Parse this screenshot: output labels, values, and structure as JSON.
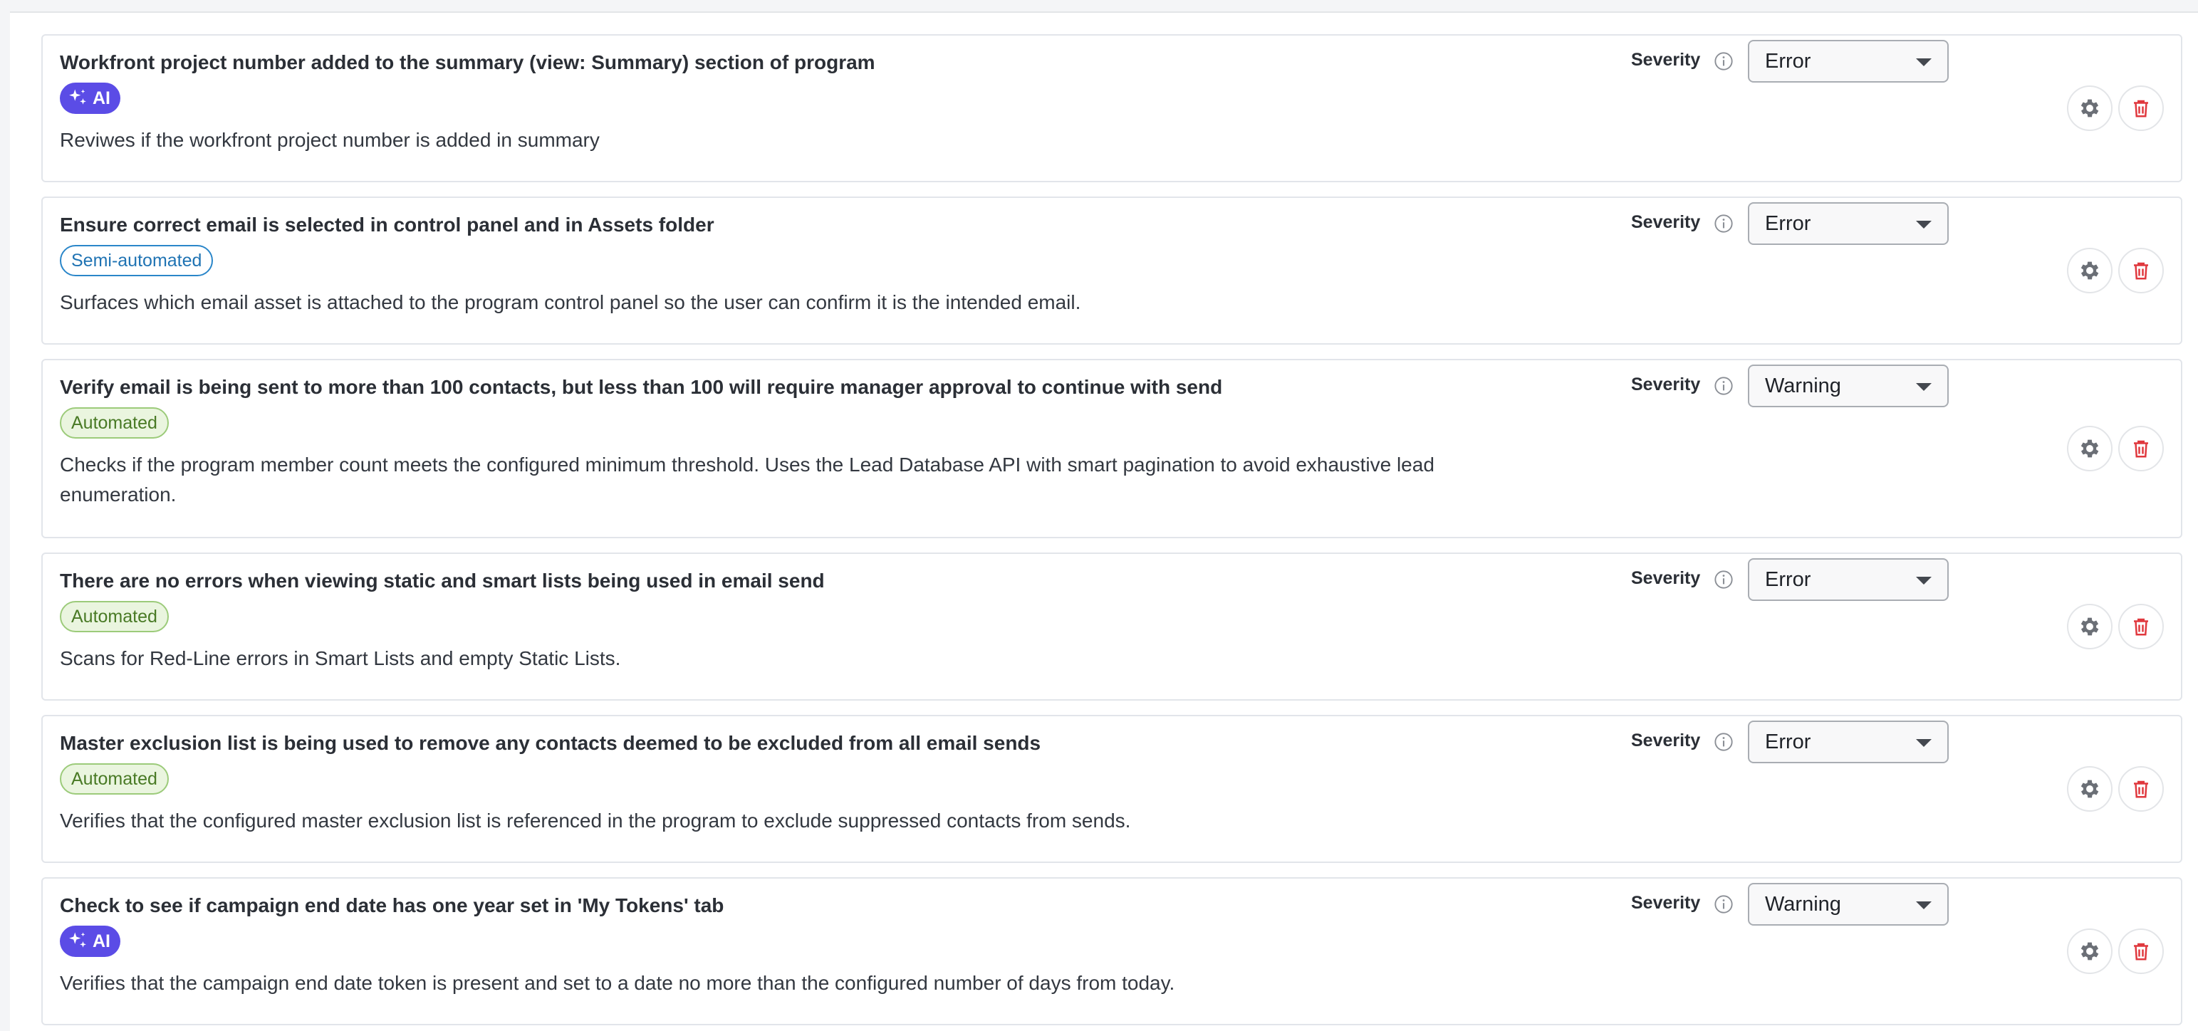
{
  "severity_label": "Severity",
  "rules": [
    {
      "title": "Workfront project number added to the summary (view: Summary) section of program",
      "badge": "AI",
      "badge_type": "ai",
      "description": "Reviwes if the workfront project number is added in summary",
      "severity": "Error"
    },
    {
      "title": "Ensure correct email is selected in control panel and in Assets folder",
      "badge": "Semi-automated",
      "badge_type": "semi",
      "description": "Surfaces which email asset is attached to the program control panel so the user can confirm it is the intended email.",
      "severity": "Error"
    },
    {
      "title": "Verify email is being sent to more than 100 contacts, but less than 100 will require manager approval to continue with send",
      "badge": "Automated",
      "badge_type": "auto",
      "description": "Checks if the program member count meets the configured minimum threshold. Uses the Lead Database API with smart pagination to avoid exhaustive lead enumeration.",
      "severity": "Warning"
    },
    {
      "title": "There are no errors when viewing static and smart lists being used in email send",
      "badge": "Automated",
      "badge_type": "auto",
      "description": "Scans for Red-Line errors in Smart Lists and empty Static Lists.",
      "severity": "Error"
    },
    {
      "title": "Master exclusion list is being used to remove any contacts deemed to be excluded from all email sends",
      "badge": "Automated",
      "badge_type": "auto",
      "description": "Verifies that the configured master exclusion list is referenced in the program to exclude suppressed contacts from sends.",
      "severity": "Error"
    },
    {
      "title": "Check to see if campaign end date has one year set in 'My Tokens' tab",
      "badge": "AI",
      "badge_type": "ai",
      "description": "Verifies that the campaign end date token is present and set to a date no more than the configured number of days from today.",
      "severity": "Warning"
    }
  ],
  "icons": {
    "badge_ai": "sparkles-icon",
    "info": "info-icon",
    "dropdown": "caret-down-icon",
    "settings": "gear-icon",
    "delete": "trash-icon"
  },
  "colors": {
    "ai_badge": "#5b4ce6",
    "semi_badge": "#2a86c9",
    "auto_badge": "#9ccb7a",
    "delete_icon": "#e0383e",
    "gear_icon": "#6b6f76"
  }
}
